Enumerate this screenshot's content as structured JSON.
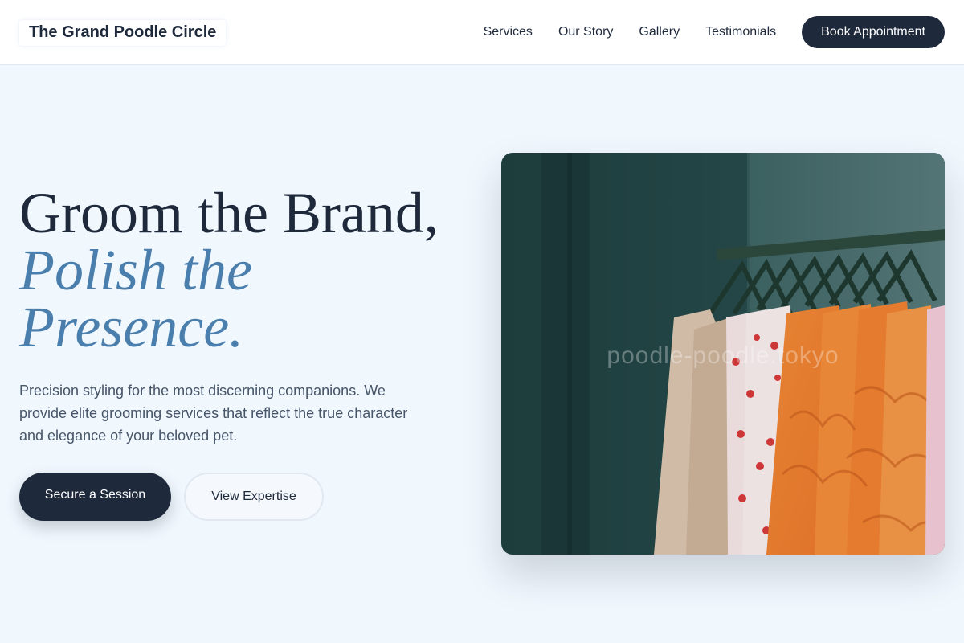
{
  "header": {
    "brand": "The Grand Poodle Circle",
    "nav": [
      "Services",
      "Our Story",
      "Gallery",
      "Testimonials"
    ],
    "cta": "Book Appointment"
  },
  "hero": {
    "title_line1": "Groom the Brand,",
    "title_accent": "Polish the Presence.",
    "description": "Precision styling for the most discerning companions. We provide elite grooming services that reflect the true character and elegance of your beloved pet.",
    "primary_button": "Secure a Session",
    "secondary_button": "View Expertise",
    "image": {
      "subject": "clothing-rack-photo",
      "watermark": "poodle-poodle.tokyo"
    }
  },
  "colors": {
    "page_background": "#f0f7fd",
    "dark_navy": "#1e293b",
    "accent_blue": "#4a7fad",
    "text_gray": "#475569"
  }
}
